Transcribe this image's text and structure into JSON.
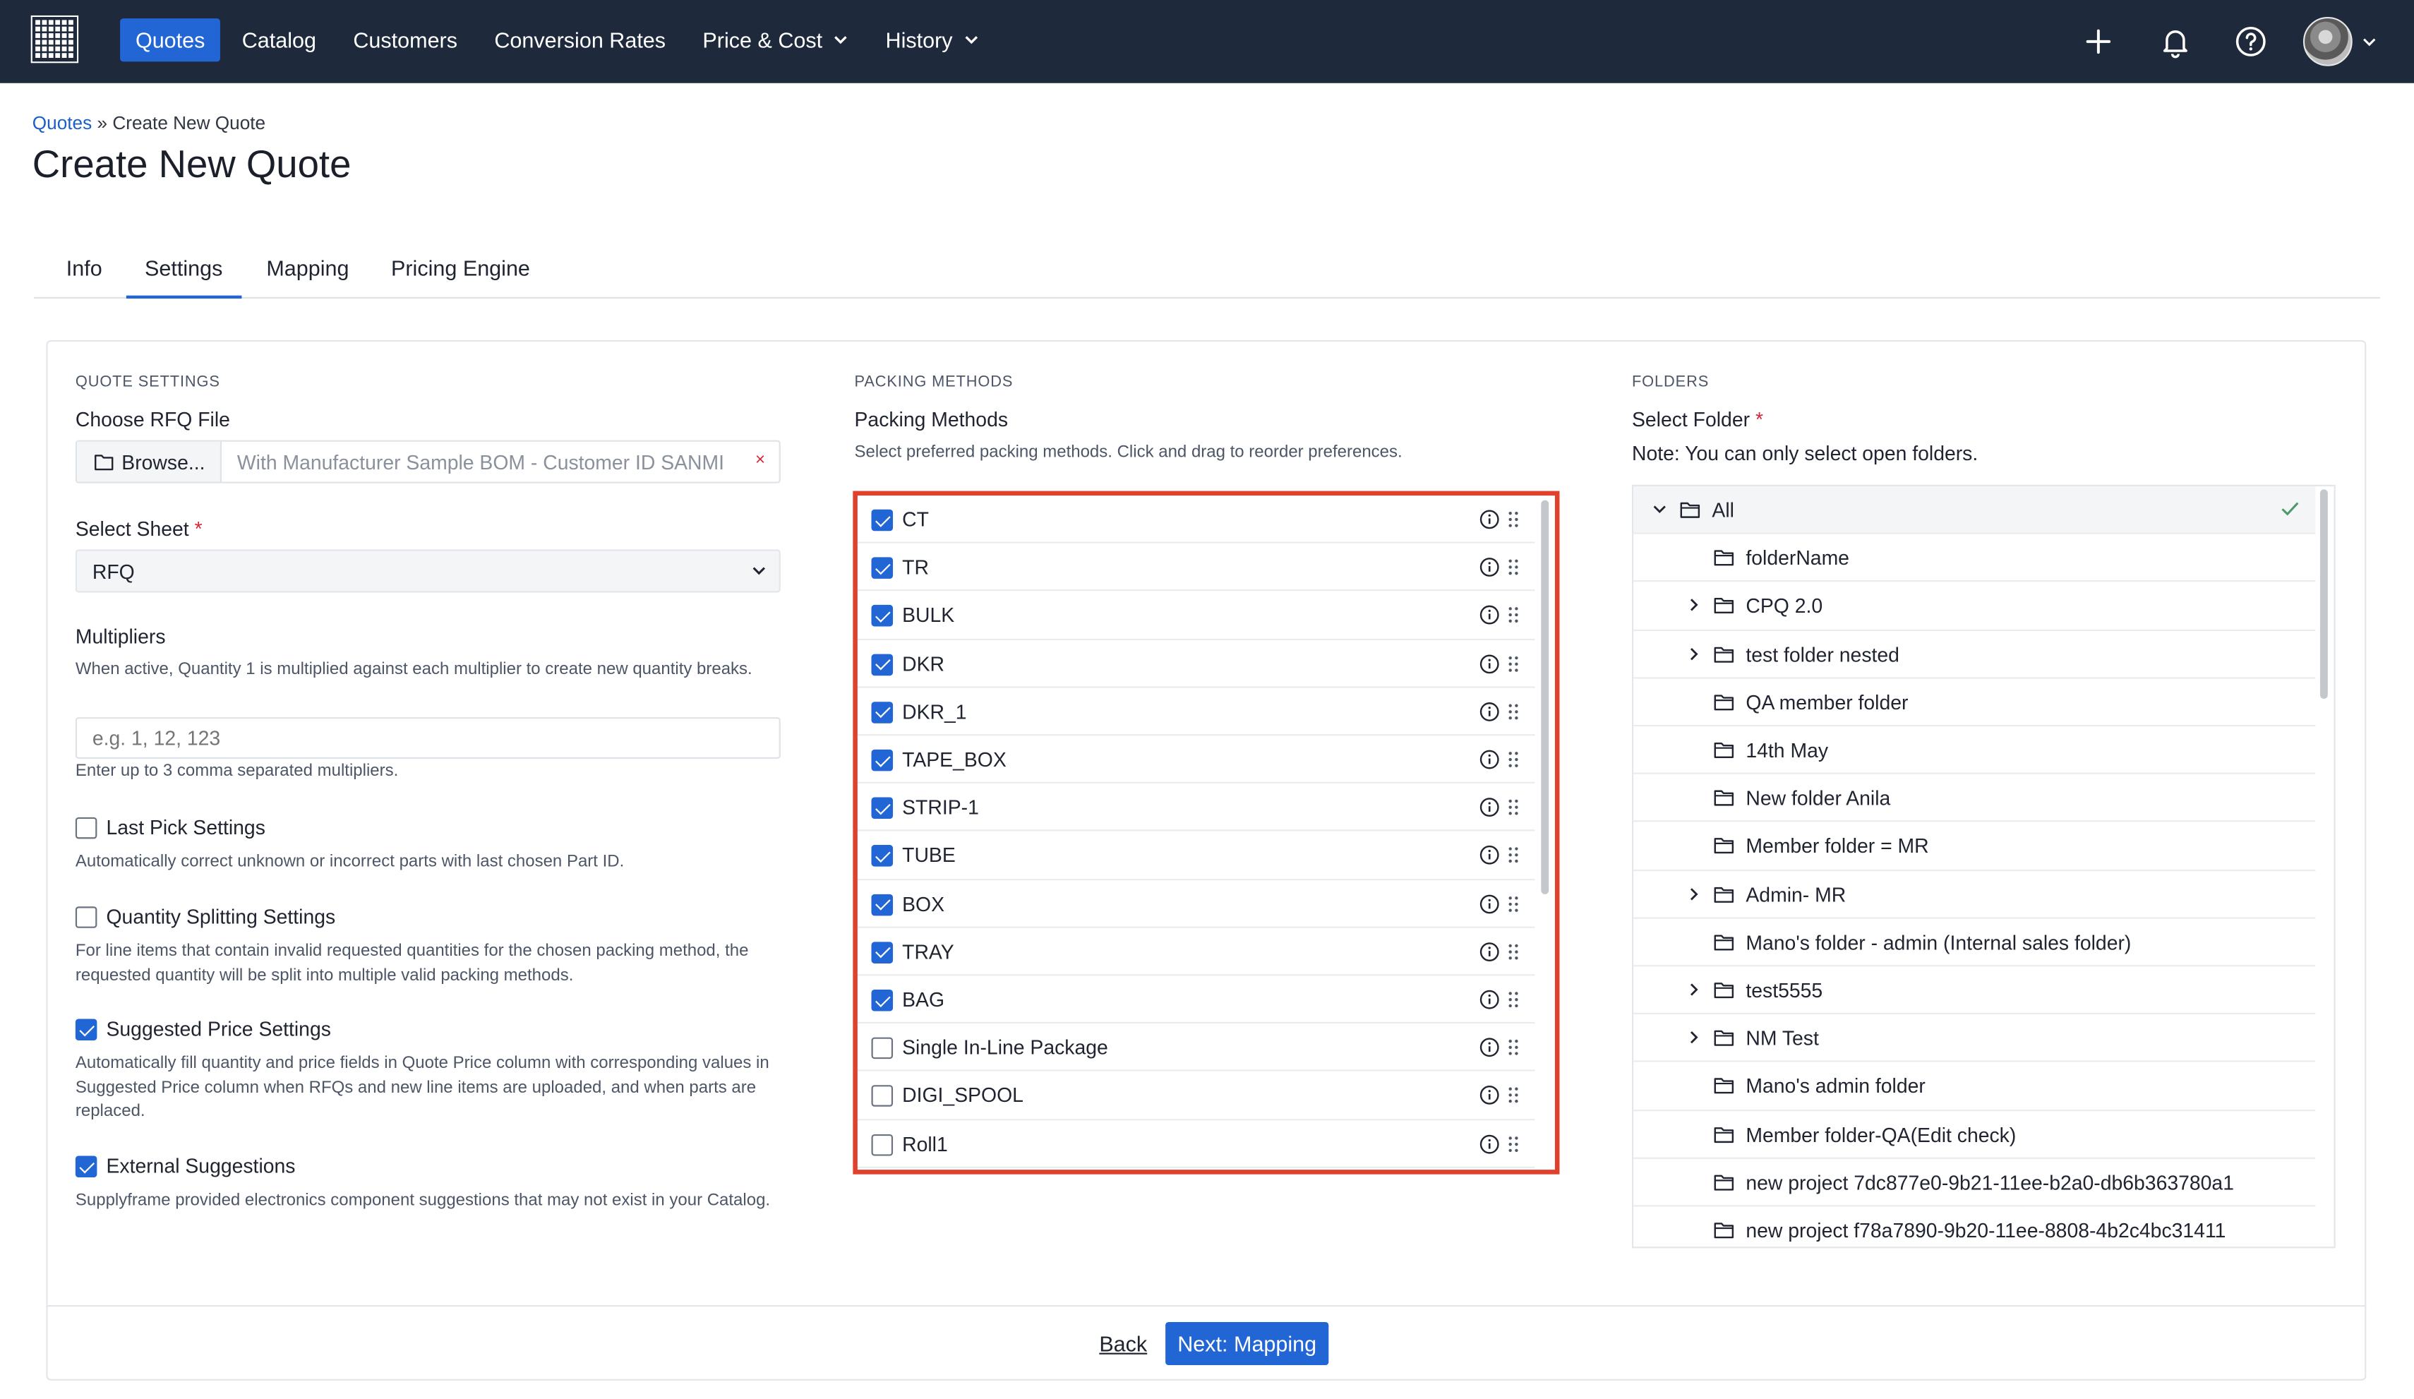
{
  "nav": {
    "items": [
      {
        "label": "Quotes",
        "active": true,
        "dropdown": false
      },
      {
        "label": "Catalog",
        "active": false,
        "dropdown": false
      },
      {
        "label": "Customers",
        "active": false,
        "dropdown": false
      },
      {
        "label": "Conversion Rates",
        "active": false,
        "dropdown": false
      },
      {
        "label": "Price & Cost",
        "active": false,
        "dropdown": true
      },
      {
        "label": "History",
        "active": false,
        "dropdown": true
      }
    ],
    "icons": [
      "grid-logo-icon",
      "plus-icon",
      "bell-icon",
      "help-icon",
      "avatar",
      "chevron-down-icon"
    ]
  },
  "breadcrumb": {
    "root": "Quotes",
    "separator": " » ",
    "current": "Create New Quote"
  },
  "page_title": "Create New Quote",
  "tabs": [
    {
      "label": "Info",
      "active": false
    },
    {
      "label": "Settings",
      "active": true
    },
    {
      "label": "Mapping",
      "active": false
    },
    {
      "label": "Pricing Engine",
      "active": false
    }
  ],
  "quote_settings": {
    "heading": "QUOTE SETTINGS",
    "rfq_label": "Choose RFQ File",
    "browse_label": "Browse...",
    "file_name": "With Manufacturer Sample BOM - Customer ID SANMI",
    "clear_glyph": "×",
    "sheet_label": "Select Sheet",
    "required_mark": "*",
    "sheet_value": "RFQ",
    "multipliers_label": "Multipliers",
    "multipliers_help": "When active, Quantity 1 is multiplied against each multiplier to create new quantity breaks.",
    "multipliers_placeholder": "e.g. 1, 12, 123",
    "multipliers_hint": "Enter up to 3 comma separated multipliers.",
    "options": [
      {
        "label": "Last Pick Settings",
        "checked": false,
        "help": "Automatically correct unknown or incorrect parts with last chosen Part ID."
      },
      {
        "label": "Quantity Splitting Settings",
        "checked": false,
        "help": "For line items that contain invalid requested quantities for the chosen packing method, the requested quantity will be split into multiple valid packing methods."
      },
      {
        "label": "Suggested Price Settings",
        "checked": true,
        "help": "Automatically fill quantity and price fields in Quote Price column with corresponding values in Suggested Price column when RFQs and new line items are uploaded, and when parts are replaced."
      },
      {
        "label": "External Suggestions",
        "checked": true,
        "help": "Supplyframe provided electronics component suggestions that may not exist in your Catalog."
      }
    ]
  },
  "packing_methods": {
    "heading": "PACKING METHODS",
    "label": "Packing Methods",
    "help": "Select preferred packing methods. Click and drag to reorder preferences.",
    "items": [
      {
        "label": "CT",
        "checked": true
      },
      {
        "label": "TR",
        "checked": true
      },
      {
        "label": "BULK",
        "checked": true
      },
      {
        "label": "DKR",
        "checked": true
      },
      {
        "label": "DKR_1",
        "checked": true
      },
      {
        "label": "TAPE_BOX",
        "checked": true
      },
      {
        "label": "STRIP-1",
        "checked": true
      },
      {
        "label": "TUBE",
        "checked": true
      },
      {
        "label": "BOX",
        "checked": true
      },
      {
        "label": "TRAY",
        "checked": true
      },
      {
        "label": "BAG",
        "checked": true
      },
      {
        "label": "Single In-Line Package",
        "checked": false
      },
      {
        "label": "DIGI_SPOOL",
        "checked": false
      },
      {
        "label": "Roll1",
        "checked": false
      }
    ]
  },
  "folders": {
    "heading": "FOLDERS",
    "label": "Select Folder",
    "required_mark": "*",
    "note": "Note: You can only select open folders.",
    "items": [
      {
        "label": "All",
        "level": 0,
        "expander": "open",
        "selected": true
      },
      {
        "label": "folderName",
        "level": 1,
        "expander": "none",
        "selected": false
      },
      {
        "label": "CPQ 2.0",
        "level": 1,
        "expander": "closed",
        "selected": false
      },
      {
        "label": "test folder nested",
        "level": 1,
        "expander": "closed",
        "selected": false
      },
      {
        "label": "QA member folder",
        "level": 1,
        "expander": "none",
        "selected": false
      },
      {
        "label": "14th May",
        "level": 1,
        "expander": "none",
        "selected": false
      },
      {
        "label": "New folder Anila",
        "level": 1,
        "expander": "none",
        "selected": false
      },
      {
        "label": "Member folder = MR",
        "level": 1,
        "expander": "none",
        "selected": false
      },
      {
        "label": "Admin- MR",
        "level": 1,
        "expander": "closed",
        "selected": false
      },
      {
        "label": "Mano's folder - admin (Internal sales folder)",
        "level": 1,
        "expander": "none",
        "selected": false
      },
      {
        "label": "test5555",
        "level": 1,
        "expander": "closed",
        "selected": false
      },
      {
        "label": "NM Test",
        "level": 1,
        "expander": "closed",
        "selected": false
      },
      {
        "label": "Mano's admin folder",
        "level": 1,
        "expander": "none",
        "selected": false
      },
      {
        "label": "Member folder-QA(Edit check)",
        "level": 1,
        "expander": "none",
        "selected": false
      },
      {
        "label": "new project 7dc877e0-9b21-11ee-b2a0-db6b363780a1",
        "level": 1,
        "expander": "none",
        "selected": false
      },
      {
        "label": "new project f78a7890-9b20-11ee-8808-4b2c4bc31411",
        "level": 1,
        "expander": "none",
        "selected": false
      }
    ]
  },
  "footer": {
    "back_label": "Back",
    "next_label": "Next: Mapping"
  },
  "colors": {
    "topbar": "#1e2a3b",
    "accent": "#2266d6",
    "highlight_border": "#e0412c",
    "required": "#d6263a"
  }
}
